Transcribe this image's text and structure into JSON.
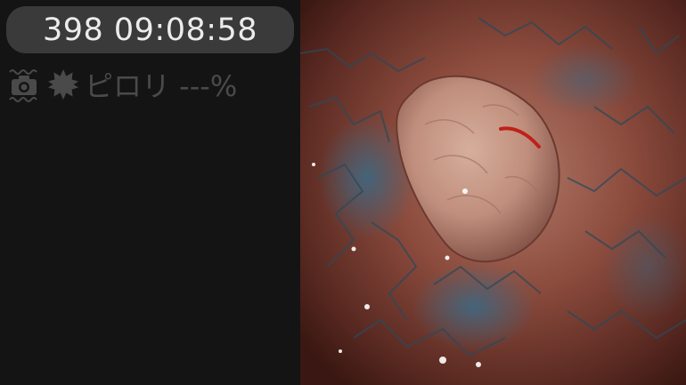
{
  "overlay": {
    "timestamp": "398 09:08:58",
    "pylori_label": "ピロリ ---%"
  },
  "icons": {
    "camera": "camera-icon",
    "indicator": "gear-icon"
  },
  "colors": {
    "panel_background": "#141414",
    "pill_background": "#3a3a3a",
    "timestamp_text": "#ececec",
    "muted_text": "#4a4a4a"
  }
}
